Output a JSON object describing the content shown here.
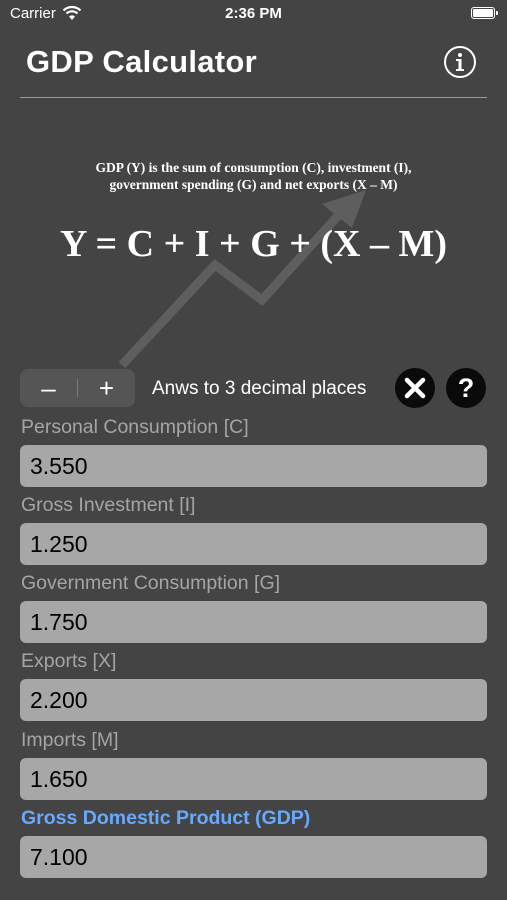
{
  "status_bar": {
    "carrier": "Carrier",
    "time": "2:36 PM"
  },
  "header": {
    "title": "GDP Calculator"
  },
  "formula": {
    "description_line1": "GDP (Y) is the sum of consumption (C), investment (I),",
    "description_line2": "government spending (G) and net exports (X – M)",
    "equation": "Y = C + I + G + (X – M)"
  },
  "controls": {
    "minus": "–",
    "plus": "+",
    "decimals_label": "Anws to 3 decimal places",
    "help": "?"
  },
  "fields": [
    {
      "label": "Personal Consumption [C]",
      "value": "3.550"
    },
    {
      "label": "Gross Investment [I]",
      "value": "1.250"
    },
    {
      "label": "Government Consumption [G]",
      "value": "1.750"
    },
    {
      "label": "Exports [X]",
      "value": "2.200"
    },
    {
      "label": "Imports [M]",
      "value": "1.650"
    }
  ],
  "result": {
    "label": "Gross Domestic Product (GDP)",
    "value": "7.100"
  },
  "colors": {
    "background": "#444444",
    "field_bg": "#a7a7a7",
    "accent": "#66a9ff"
  },
  "icons": [
    "wifi-icon",
    "battery-icon",
    "info-icon",
    "trend-arrow-icon",
    "clear-icon"
  ]
}
